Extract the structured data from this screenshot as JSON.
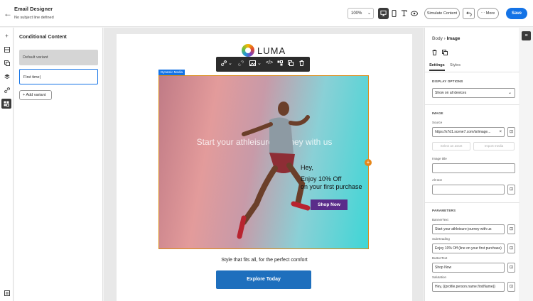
{
  "header": {
    "back_glyph": "←",
    "title": "Email Designer",
    "subtitle": "No subject line defined",
    "zoom": "100%",
    "simulate_label": "Simulate Content",
    "more_label": "More",
    "save_label": "Save"
  },
  "left_panel": {
    "title": "Conditional Content",
    "variants": [
      "Default variant",
      "First time"
    ],
    "add_label": "Add variant"
  },
  "email": {
    "logo_text": "LUMA",
    "dynamic_tag": "Dynamic Media",
    "hero_headline": "Start your athleisure journey with us",
    "hey": "Hey,",
    "offer_line1": "Enjoy 10% Off",
    "offer_line2": "on your first purchase",
    "shop_label": "Shop Now",
    "tagline": "Style that fits all, for the perfect comfort",
    "explore_label": "Explore Today"
  },
  "right_panel": {
    "crumb_parent": "Body",
    "crumb_sep": "›",
    "crumb_current": "Image",
    "tabs": [
      "Settings",
      "Styles"
    ],
    "display_section": "DISPLAY OPTIONS",
    "display_value": "Show on all devices",
    "image_section": "IMAGE",
    "source_label": "Source",
    "source_value": "https://s7d1.scene7.com/is/image...",
    "select_asset": "Select an asset",
    "import_media": "Import media",
    "image_title_label": "Image title",
    "alt_text_label": "Alt text",
    "params_section": "PARAMETERS",
    "params": [
      {
        "label": "BannerText",
        "value": "Start your athleisure journey with us"
      },
      {
        "label": "SubHeading",
        "value": "Enjoy 10% Off (line on your first purchase)"
      },
      {
        "label": "ButtonText",
        "value": "Shop Now"
      },
      {
        "label": "Salutation",
        "value": "Hey, {{profile.person.name.firstName}}"
      }
    ]
  }
}
